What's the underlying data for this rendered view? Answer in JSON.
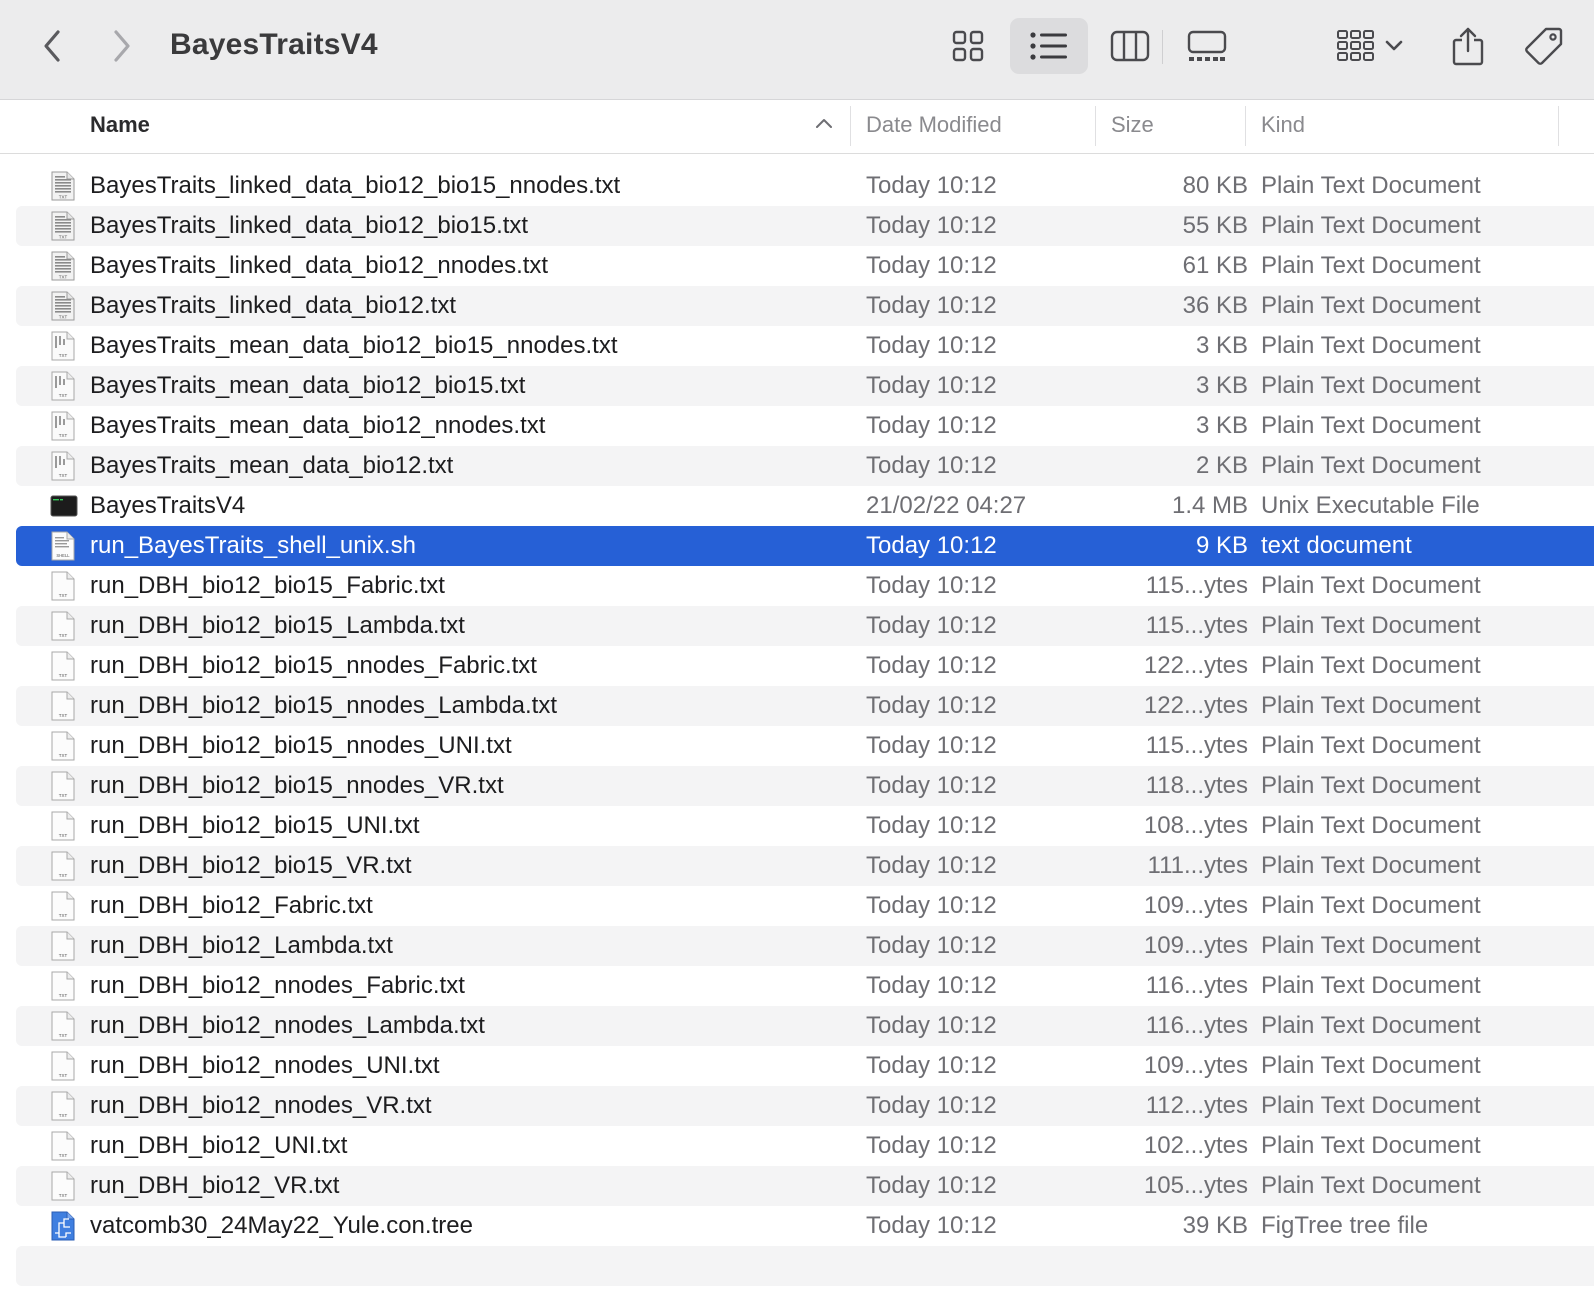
{
  "window": {
    "title": "BayesTraitsV4"
  },
  "toolbar": {
    "back_icon": "chevron-left-icon",
    "forward_icon": "chevron-right-icon",
    "views": [
      "icon-view",
      "list-view",
      "column-view",
      "gallery-view"
    ],
    "active_view": "list-view",
    "accent": "#2660d6"
  },
  "columns": {
    "name": "Name",
    "date": "Date Modified",
    "size": "Size",
    "kind": "Kind"
  },
  "files": [
    {
      "name": "BayesTraits_linked_data_bio12_bio15_nnodes.txt",
      "date": "Today 10:12",
      "size": "80 KB",
      "kind": "Plain Text Document",
      "icon": "txt-dense"
    },
    {
      "name": "BayesTraits_linked_data_bio12_bio15.txt",
      "date": "Today 10:12",
      "size": "55 KB",
      "kind": "Plain Text Document",
      "icon": "txt-dense"
    },
    {
      "name": "BayesTraits_linked_data_bio12_nnodes.txt",
      "date": "Today 10:12",
      "size": "61 KB",
      "kind": "Plain Text Document",
      "icon": "txt-dense"
    },
    {
      "name": "BayesTraits_linked_data_bio12.txt",
      "date": "Today 10:12",
      "size": "36 KB",
      "kind": "Plain Text Document",
      "icon": "txt-dense"
    },
    {
      "name": "BayesTraits_mean_data_bio12_bio15_nnodes.txt",
      "date": "Today 10:12",
      "size": "3 KB",
      "kind": "Plain Text Document",
      "icon": "txt-light"
    },
    {
      "name": "BayesTraits_mean_data_bio12_bio15.txt",
      "date": "Today 10:12",
      "size": "3 KB",
      "kind": "Plain Text Document",
      "icon": "txt-light"
    },
    {
      "name": "BayesTraits_mean_data_bio12_nnodes.txt",
      "date": "Today 10:12",
      "size": "3 KB",
      "kind": "Plain Text Document",
      "icon": "txt-light"
    },
    {
      "name": "BayesTraits_mean_data_bio12.txt",
      "date": "Today 10:12",
      "size": "2 KB",
      "kind": "Plain Text Document",
      "icon": "txt-light"
    },
    {
      "name": "BayesTraitsV4",
      "date": "21/02/22 04:27",
      "size": "1.4 MB",
      "kind": "Unix Executable File",
      "icon": "exec"
    },
    {
      "name": "run_BayesTraits_shell_unix.sh",
      "date": "Today 10:12",
      "size": "9 KB",
      "kind": "text document",
      "icon": "shell",
      "selected": true
    },
    {
      "name": "run_DBH_bio12_bio15_Fabric.txt",
      "date": "Today 10:12",
      "size": "115...ytes",
      "kind": "Plain Text Document",
      "icon": "txt"
    },
    {
      "name": "run_DBH_bio12_bio15_Lambda.txt",
      "date": "Today 10:12",
      "size": "115...ytes",
      "kind": "Plain Text Document",
      "icon": "txt"
    },
    {
      "name": "run_DBH_bio12_bio15_nnodes_Fabric.txt",
      "date": "Today 10:12",
      "size": "122...ytes",
      "kind": "Plain Text Document",
      "icon": "txt"
    },
    {
      "name": "run_DBH_bio12_bio15_nnodes_Lambda.txt",
      "date": "Today 10:12",
      "size": "122...ytes",
      "kind": "Plain Text Document",
      "icon": "txt"
    },
    {
      "name": "run_DBH_bio12_bio15_nnodes_UNI.txt",
      "date": "Today 10:12",
      "size": "115...ytes",
      "kind": "Plain Text Document",
      "icon": "txt"
    },
    {
      "name": "run_DBH_bio12_bio15_nnodes_VR.txt",
      "date": "Today 10:12",
      "size": "118...ytes",
      "kind": "Plain Text Document",
      "icon": "txt"
    },
    {
      "name": "run_DBH_bio12_bio15_UNI.txt",
      "date": "Today 10:12",
      "size": "108...ytes",
      "kind": "Plain Text Document",
      "icon": "txt"
    },
    {
      "name": "run_DBH_bio12_bio15_VR.txt",
      "date": "Today 10:12",
      "size": "111...ytes",
      "kind": "Plain Text Document",
      "icon": "txt"
    },
    {
      "name": "run_DBH_bio12_Fabric.txt",
      "date": "Today 10:12",
      "size": "109...ytes",
      "kind": "Plain Text Document",
      "icon": "txt"
    },
    {
      "name": "run_DBH_bio12_Lambda.txt",
      "date": "Today 10:12",
      "size": "109...ytes",
      "kind": "Plain Text Document",
      "icon": "txt"
    },
    {
      "name": "run_DBH_bio12_nnodes_Fabric.txt",
      "date": "Today 10:12",
      "size": "116...ytes",
      "kind": "Plain Text Document",
      "icon": "txt"
    },
    {
      "name": "run_DBH_bio12_nnodes_Lambda.txt",
      "date": "Today 10:12",
      "size": "116...ytes",
      "kind": "Plain Text Document",
      "icon": "txt"
    },
    {
      "name": "run_DBH_bio12_nnodes_UNI.txt",
      "date": "Today 10:12",
      "size": "109...ytes",
      "kind": "Plain Text Document",
      "icon": "txt"
    },
    {
      "name": "run_DBH_bio12_nnodes_VR.txt",
      "date": "Today 10:12",
      "size": "112...ytes",
      "kind": "Plain Text Document",
      "icon": "txt"
    },
    {
      "name": "run_DBH_bio12_UNI.txt",
      "date": "Today 10:12",
      "size": "102...ytes",
      "kind": "Plain Text Document",
      "icon": "txt"
    },
    {
      "name": "run_DBH_bio12_VR.txt",
      "date": "Today 10:12",
      "size": "105...ytes",
      "kind": "Plain Text Document",
      "icon": "txt"
    },
    {
      "name": "vatcomb30_24May22_Yule.con.tree",
      "date": "Today 10:12",
      "size": "39 KB",
      "kind": "FigTree tree file",
      "icon": "figtree"
    }
  ]
}
